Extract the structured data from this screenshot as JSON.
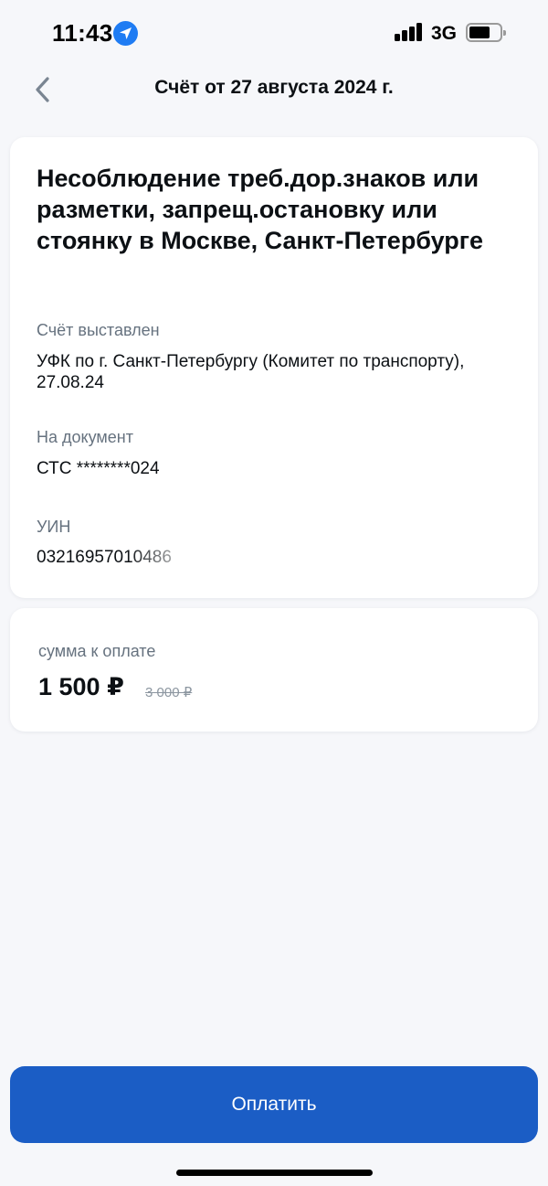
{
  "status_bar": {
    "time": "11:43",
    "network": "3G",
    "icons": [
      "location-arrow-icon",
      "signal-icon",
      "battery-icon"
    ]
  },
  "header": {
    "title": "Счёт от 27 августа 2024 г.",
    "back_icon": "chevron-left-icon"
  },
  "invoice": {
    "title": "Несоблюдение треб.дор.знаков или разметки, запрещ.остановку или стоянку в Москве, Санкт-Петербурге",
    "issued_label": "Счёт выставлен",
    "issued_value": "УФК по г. Санкт-Петербургу (Комитет по транспорту), 27.08.24",
    "document_label": "На документ",
    "document_value": "СТС ********024",
    "uin_label": "УИН",
    "uin_value": "03216957010486"
  },
  "payment": {
    "label": "сумма к оплате",
    "amount": "1 500 ₽",
    "old_amount": "3 000 ₽"
  },
  "actions": {
    "pay_label": "Оплатить"
  },
  "colors": {
    "accent": "#1b5dc5",
    "location_badge": "#1f7cf3",
    "label_gray": "#66727f",
    "background": "#f6f7fa"
  }
}
